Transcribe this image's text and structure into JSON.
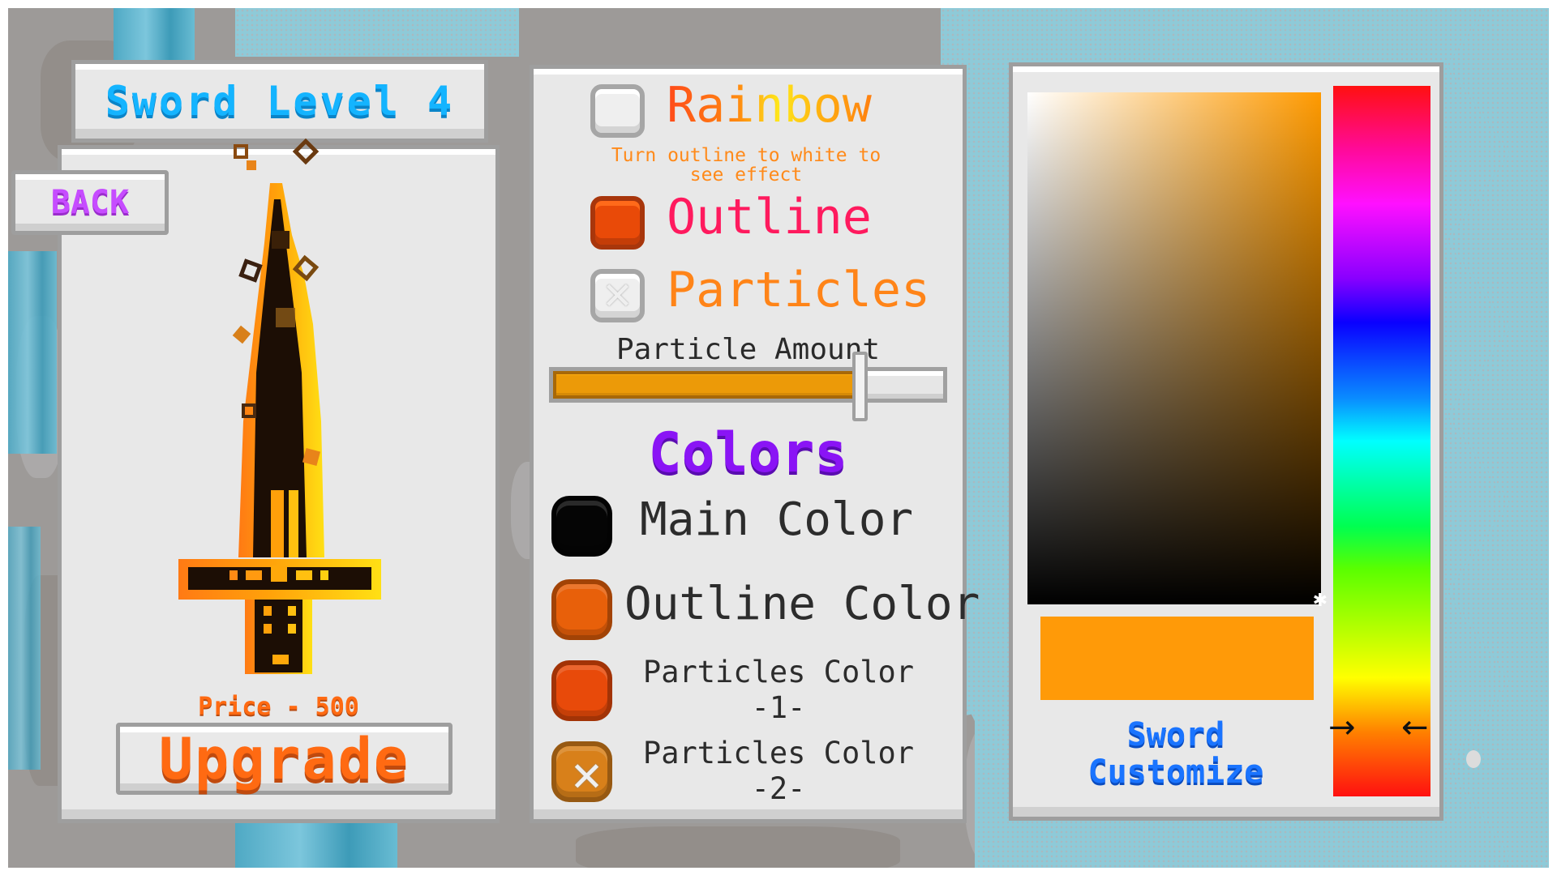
{
  "header": {
    "title": "Sword Level 4"
  },
  "back_button": {
    "label": "BACK"
  },
  "shop": {
    "price_text": "Price - 500",
    "upgrade_label": "Upgrade"
  },
  "options": {
    "rainbow": {
      "label": "Rainbow",
      "checked": false
    },
    "hint": {
      "line1": "Turn outline to white to",
      "line2": "see effect"
    },
    "outline": {
      "label": "Outline",
      "checked": true,
      "color": "#e94a08"
    },
    "particles": {
      "label": "Particles",
      "checked": false
    }
  },
  "particle_amount": {
    "label": "Particle Amount",
    "value_fraction": 0.78
  },
  "colors": {
    "heading": "Colors",
    "main": {
      "label": "Main Color",
      "color": "#050505"
    },
    "outline": {
      "label": "Outline Color",
      "color": "#e8600a"
    },
    "particles1": {
      "line1": "Particles Color",
      "line2": "-1-",
      "color": "#e84a0a"
    },
    "particles2": {
      "line1": "Particles Color",
      "line2": "-2-",
      "color": "#d8801a",
      "disabled_icon": "x-icon"
    }
  },
  "picker": {
    "hue_color": "#ff9a00",
    "selected_color": "#ff9a08",
    "hue_position_fraction": 0.905,
    "saturation": 1.0,
    "value": 1.0,
    "title_line1": "Sword",
    "title_line2": "Customize",
    "arrow_right": "→",
    "arrow_left": "←"
  },
  "colors_theme": {
    "title_blue": "#14b4ff",
    "back_purple": "#c64cff",
    "price_orange": "#ff6a12",
    "heading_purple": "#8a14f5",
    "customize_blue": "#1a74ff"
  }
}
